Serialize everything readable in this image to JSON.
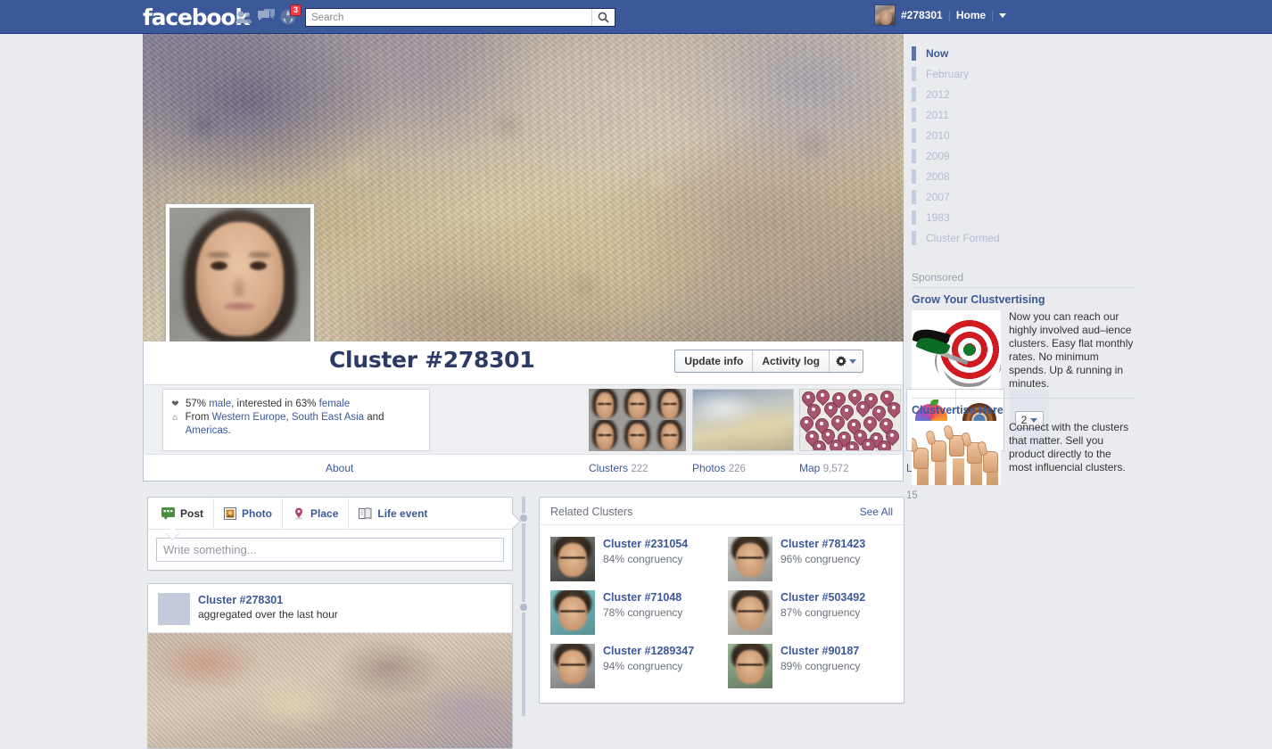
{
  "topbar": {
    "logo": "facebook",
    "icons": [
      "friends-icon",
      "messages-icon",
      "globe-icon"
    ],
    "notification_count": "3",
    "search_placeholder": "Search",
    "search_value": "",
    "user_name": "#278301",
    "home_label": "Home",
    "accent_color": "#3b5998",
    "badge_color": "#fa3c4c"
  },
  "profile": {
    "name": "Cluster #278301",
    "buttons": {
      "update_info": "Update info",
      "activity_log": "Activity log"
    },
    "about": {
      "gender_prefix": "57% ",
      "gender": "male",
      "interested_mid": ", interested in 63% ",
      "interested": "female",
      "from_prefix": "From ",
      "places": [
        "Western Europe",
        "South East Asia"
      ],
      "places_sep": ", ",
      "and": " and ",
      "last_place": "Americas",
      "period": "."
    },
    "more_count": "2"
  },
  "tabs": [
    {
      "label": "About",
      "count": ""
    },
    {
      "label": "Clusters",
      "count": "222"
    },
    {
      "label": "Photos",
      "count": "226"
    },
    {
      "label": "Map",
      "count": "9,572"
    },
    {
      "label": "Likes",
      "count": "15"
    }
  ],
  "composer": {
    "tabs": [
      {
        "label": "Post",
        "icon": "post-icon"
      },
      {
        "label": "Photo",
        "icon": "photo-icon"
      },
      {
        "label": "Place",
        "icon": "place-pin-icon"
      },
      {
        "label": "Life event",
        "icon": "life-event-icon"
      }
    ],
    "placeholder": "Write something..."
  },
  "post": {
    "author": "Cluster #278301",
    "meta": "aggregated over the last hour"
  },
  "related": {
    "title": "Related Clusters",
    "see_all": "See All",
    "items": [
      {
        "name": "Cluster #231054",
        "congruency": "84% congruency"
      },
      {
        "name": "Cluster #781423",
        "congruency": "96% congruency"
      },
      {
        "name": "Cluster #71048",
        "congruency": "78% congruency"
      },
      {
        "name": "Cluster #503492",
        "congruency": "87% congruency"
      },
      {
        "name": "Cluster #1289347",
        "congruency": "94% congruency"
      },
      {
        "name": "Cluster #90187",
        "congruency": "89% congruency"
      }
    ]
  },
  "timeline_nav": {
    "items": [
      {
        "label": "Now",
        "active": true
      },
      {
        "label": "February",
        "active": false
      },
      {
        "label": "2012",
        "active": false
      },
      {
        "label": "2011",
        "active": false
      },
      {
        "label": "2010",
        "active": false
      },
      {
        "label": "2009",
        "active": false
      },
      {
        "label": "2008",
        "active": false
      },
      {
        "label": "2007",
        "active": false
      },
      {
        "label": "1983",
        "active": false
      },
      {
        "label": "Cluster Formed",
        "active": false
      }
    ]
  },
  "sponsored": {
    "label": "Sponsored",
    "ads": [
      {
        "title": "Grow Your Clustvertising",
        "text": "Now you can reach our highly involved aud–ience clusters. Easy flat monthly rates. No minimum spends. Up & running in minutes.",
        "image": "dartboard-image"
      },
      {
        "title": "Clustvertise Here",
        "text": "Connect with the clusters that matter. Sell you product directly to the most influencial clusters.",
        "image": "thumbs-up-image"
      }
    ]
  }
}
